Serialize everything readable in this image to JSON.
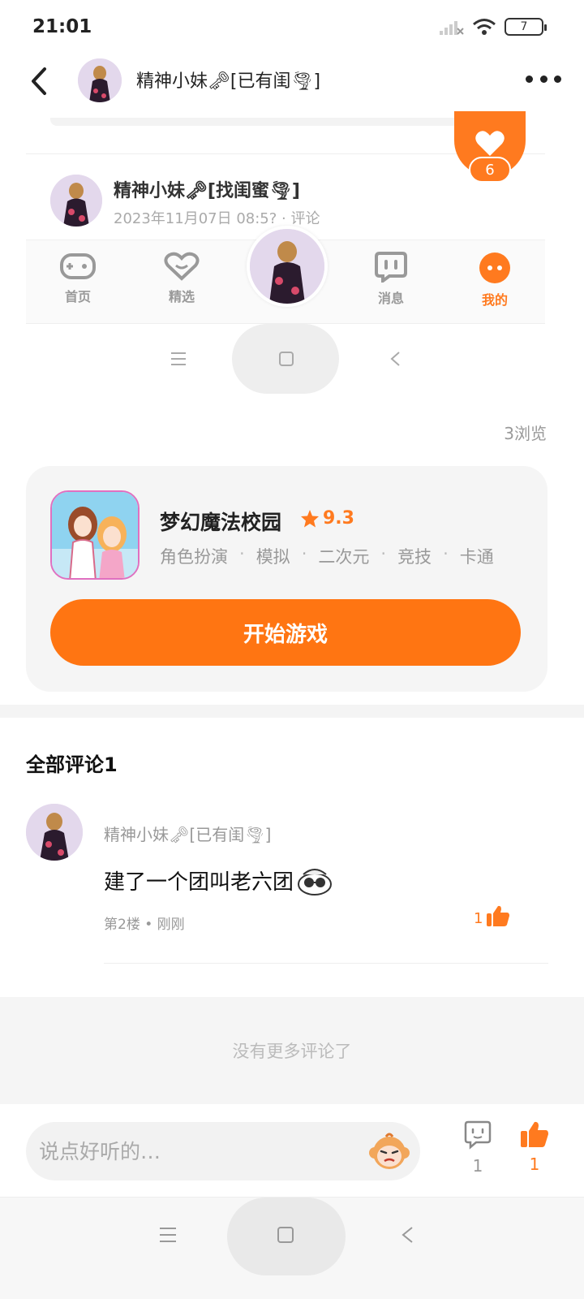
{
  "status_bar": {
    "time": "21:01",
    "battery": "7"
  },
  "header": {
    "author_name": "精神小妹🗝[已有闺🌪]"
  },
  "embedded_post": {
    "like_count": "6",
    "author_name": "精神小妹🗝[找闺蜜🌪]",
    "meta": "2023年11月07日 08:5?  ·  评论",
    "nav": {
      "home": "首页",
      "featured": "精选",
      "messages": "消息",
      "mine": "我的"
    }
  },
  "views": "3浏览",
  "game": {
    "name": "梦幻魔法校园",
    "rating": "9.3",
    "tags": [
      "角色扮演",
      "模拟",
      "二次元",
      "竞技",
      "卡通"
    ],
    "start_label": "开始游戏"
  },
  "comments": {
    "title": "全部评论1",
    "items": [
      {
        "author": "精神小妹🗝[已有闺🌪]",
        "text": "建了一个团叫老六团",
        "meta": "第2楼 • 刚刚",
        "likes": "1"
      }
    ],
    "no_more": "没有更多评论了"
  },
  "bottom_bar": {
    "input_placeholder": "说点好听的…",
    "comment_count": "1",
    "like_count": "1"
  },
  "colors": {
    "accent": "#ff7a1f",
    "card_bg": "#f5f5f5"
  }
}
